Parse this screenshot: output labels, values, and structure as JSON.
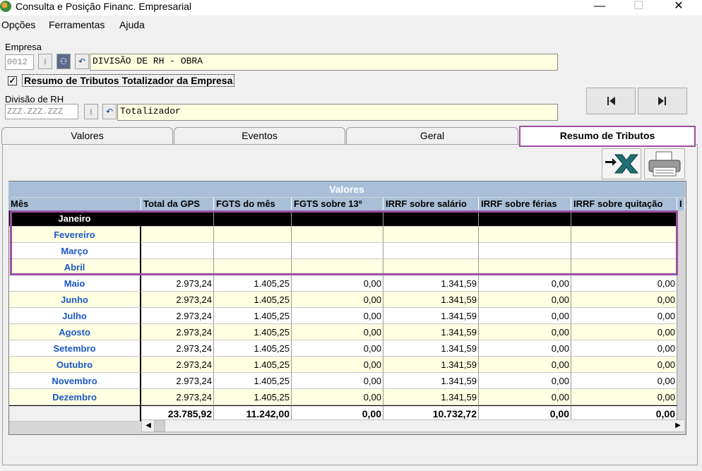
{
  "window": {
    "title": "Consulta e Posição Financ. Empresarial",
    "min": "—",
    "max": "☐",
    "close": "✕"
  },
  "menu": [
    "Opções",
    "Ferramentas",
    "Ajuda"
  ],
  "empresa": {
    "label": "Empresa",
    "code": "0012",
    "name": "DIVISÃO DE RH - OBRA"
  },
  "checkbox": {
    "label": "Resumo de Tributos Totalizador da Empresa",
    "checked": "✓"
  },
  "divisao": {
    "label": "Divisão de RH",
    "code": "ZZZ.ZZZ.ZZZ",
    "name": "Totalizador"
  },
  "tabs": [
    "Valores",
    "Eventos",
    "Geral",
    "Resumo de Tributos"
  ],
  "grid": {
    "group_title": "Valores",
    "columns": [
      "Mês",
      "Total da GPS",
      "FGTS do mês",
      "FGTS sobre 13º",
      "IRRF sobre salário",
      "IRRF sobre férias",
      "IRRF sobre quitação",
      "I"
    ],
    "rows": [
      [
        "Janeiro",
        "",
        "",
        "",
        "",
        "",
        ""
      ],
      [
        "Fevereiro",
        "",
        "",
        "",
        "",
        "",
        ""
      ],
      [
        "Março",
        "",
        "",
        "",
        "",
        "",
        ""
      ],
      [
        "Abril",
        "",
        "",
        "",
        "",
        "",
        ""
      ],
      [
        "Maio",
        "2.973,24",
        "1.405,25",
        "0,00",
        "1.341,59",
        "0,00",
        "0,00"
      ],
      [
        "Junho",
        "2.973,24",
        "1.405,25",
        "0,00",
        "1.341,59",
        "0,00",
        "0,00"
      ],
      [
        "Julho",
        "2.973,24",
        "1.405,25",
        "0,00",
        "1.341,59",
        "0,00",
        "0,00"
      ],
      [
        "Agosto",
        "2.973,24",
        "1.405,25",
        "0,00",
        "1.341,59",
        "0,00",
        "0,00"
      ],
      [
        "Setembro",
        "2.973,24",
        "1.405,25",
        "0,00",
        "1.341,59",
        "0,00",
        "0,00"
      ],
      [
        "Outubro",
        "2.973,24",
        "1.405,25",
        "0,00",
        "1.341,59",
        "0,00",
        "0,00"
      ],
      [
        "Novembro",
        "2.973,24",
        "1.405,25",
        "0,00",
        "1.341,59",
        "0,00",
        "0,00"
      ],
      [
        "Dezembro",
        "2.973,24",
        "1.405,25",
        "0,00",
        "1.341,59",
        "0,00",
        "0,00"
      ]
    ],
    "totals": [
      "",
      "23.785,92",
      "11.242,00",
      "0,00",
      "10.732,72",
      "0,00",
      "0,00"
    ]
  },
  "colors": {
    "header": "#a8bfd7",
    "highlight": "#9b4fa3",
    "month_text": "#1c57c8",
    "row_yellow": "#ffffe1"
  }
}
